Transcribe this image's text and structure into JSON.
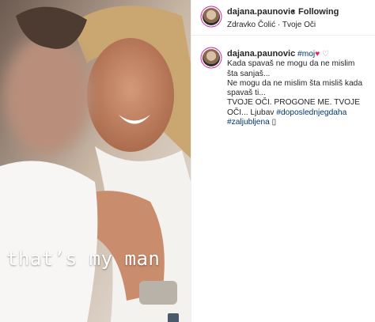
{
  "post": {
    "overlay_text": "that’s my man",
    "header": {
      "username": "dajana.paunovic",
      "separator": "•",
      "follow_label": "Following",
      "audio": "Zdravko Čolić · Tvoje Oči"
    },
    "caption": {
      "username": "dajana.paunovic",
      "hashtag1": "#moj",
      "heart": "♥",
      "extra": "♡",
      "line1": "Kada spavaš ne mogu da ne mislim",
      "line2": "šta sanjaš...",
      "line3": "Ne mogu da ne mislim šta misliš kada",
      "line4": "spavaš ti...",
      "line5": "TVOJE OČI. PROGONE ME. TVOJE",
      "line6_text": "OČI... Ljubav",
      "line6_tag": "#doposlednjegdaha",
      "line7_tag": "#zaljubljena",
      "line7_end": "▯"
    }
  },
  "colors": {
    "link": "#00376b",
    "heart": "#e0245e",
    "border": "#efefef"
  }
}
